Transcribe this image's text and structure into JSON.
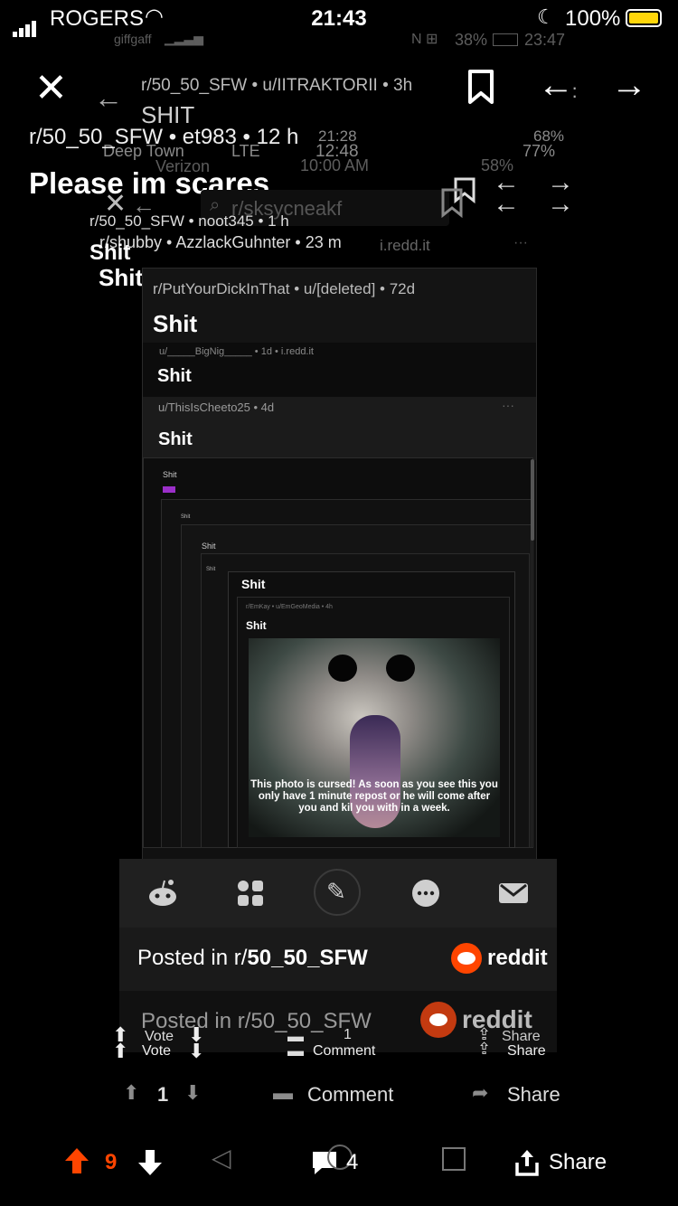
{
  "status": {
    "carrier": "ROGERS",
    "time": "21:43",
    "battery": "100%",
    "ghost_carrier": "giffgaff",
    "ghost_battery": "38%",
    "ghost_time": "23:47",
    "ghost2_carrier": "Deep Town",
    "ghost2_network": "LTE",
    "ghost2_time": "12:48",
    "ghost2_battery": "77%",
    "ghost3_carrier": "Verizon",
    "ghost3_time": "10:00 AM",
    "ghost3_battery": "58%",
    "ghost4_time": "21:28",
    "ghost4_battery": "68%"
  },
  "header": {
    "meta_top": "r/50_50_SFW • u/IITRAKTORII • 3h",
    "shit_caps": "SHIT",
    "meta_main": "r/50_50_SFW • et983 • 12 h",
    "title": "Please im scares",
    "meta_noot": "r/50_50_SFW • noot345 • 1 h",
    "search_ghost": "r/sksycneakf",
    "meta_shubby": "r/shubby • AzzlackGuhnter • 23 m",
    "domain": "i.redd.it",
    "shit1": "Shit",
    "shit2": "Shit"
  },
  "card": {
    "meta": "r/PutYourDickInThat • u/[deleted] • 72d",
    "title": "Shit",
    "meta2": "u/_____BigNig_____ • 1d • i.redd.it",
    "title2": "Shit",
    "meta3": "u/ThisIsCheeto25 • 4d",
    "title3": "Shit",
    "tiny1": "Shit",
    "tiny2": "Shit",
    "tiny3": "Shit",
    "tiny4": "Shit",
    "meta4": "r/EmKay • u/EmGeoMedia • 4h",
    "title4": "Shit",
    "title5": "Shit",
    "cursed_text": "This photo is cursed! As soon as you see this you only have 1 minute repost or he will come after you and kil you with in a week."
  },
  "posted": {
    "label": "Posted in r/",
    "sub": "50_50_SFW",
    "brand": "reddit",
    "label2": "Posted in r/50_50_SFW",
    "brand2": "reddit"
  },
  "ghost_actions": {
    "vote": "Vote",
    "vote2": "Vote",
    "count": "1",
    "comment": "Comment",
    "share": "Share",
    "share2": "Share"
  },
  "actions": {
    "count": "1",
    "comment": "Comment",
    "share": "Share"
  },
  "bottom": {
    "votes": "9",
    "comments": "4",
    "share": "Share",
    "accent": "#ff4500"
  },
  "icons": [
    "close-icon",
    "back-arrow-icon",
    "forward-arrow-icon",
    "bookmark-icon",
    "upvote-icon",
    "downvote-icon",
    "comment-icon",
    "share-icon",
    "reddit-icon",
    "apps-icon",
    "pencil-icon",
    "chat-icon",
    "mail-icon"
  ]
}
